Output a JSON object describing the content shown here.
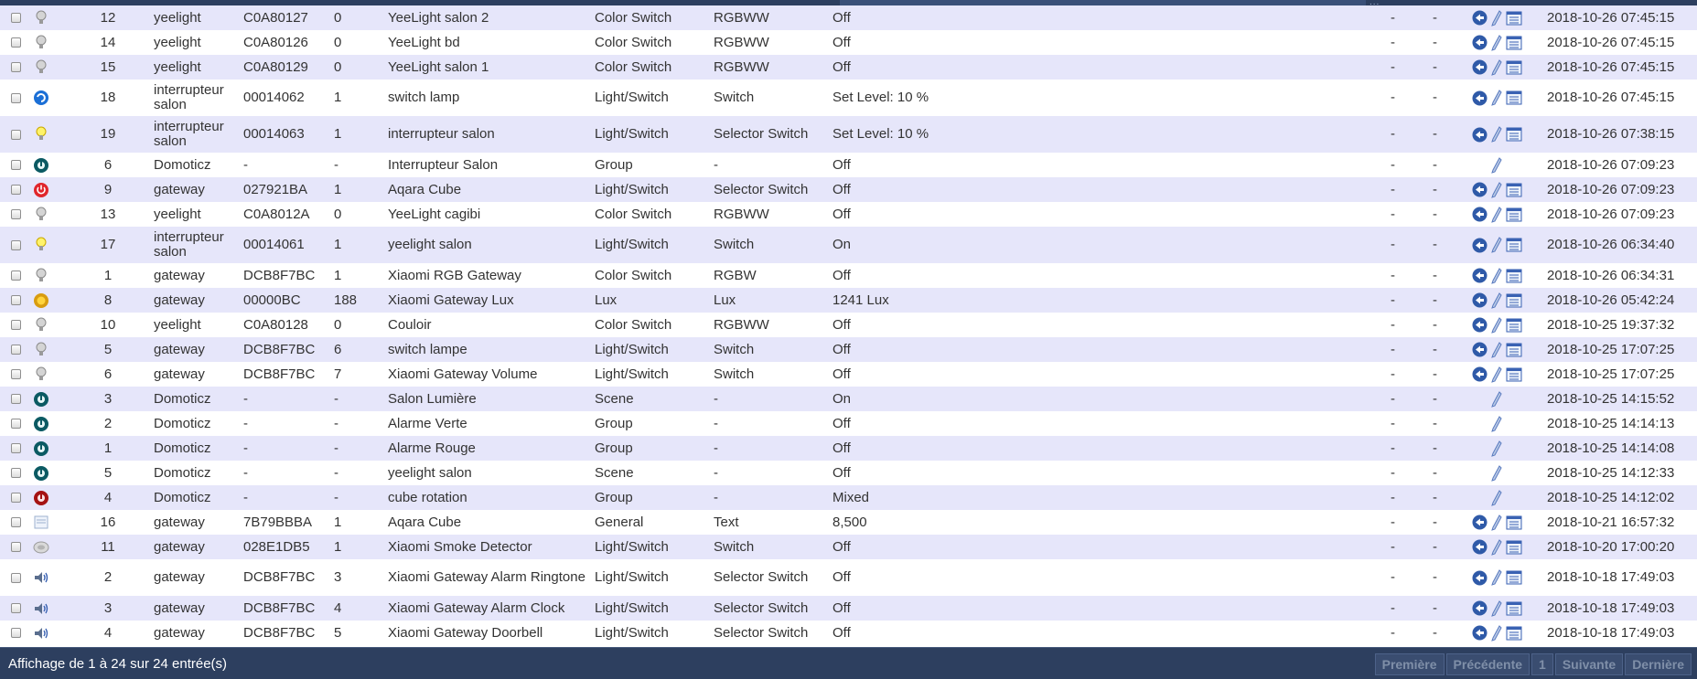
{
  "columns_header": {
    "more": "..."
  },
  "rows": [
    {
      "idx": "12",
      "hardware": "yeelight",
      "id": "C0A80127",
      "unit": "0",
      "name": "YeeLight salon 2",
      "type": "Color Switch",
      "subtype": "RGBWW",
      "data": "Off",
      "a": "-",
      "b": "-",
      "last": "2018-10-26 07:45:15",
      "icon": "bulb-grey-icon",
      "actions": true,
      "tall": false
    },
    {
      "idx": "14",
      "hardware": "yeelight",
      "id": "C0A80126",
      "unit": "0",
      "name": "YeeLight bd",
      "type": "Color Switch",
      "subtype": "RGBWW",
      "data": "Off",
      "a": "-",
      "b": "-",
      "last": "2018-10-26 07:45:15",
      "icon": "bulb-grey-icon",
      "actions": true,
      "tall": false
    },
    {
      "idx": "15",
      "hardware": "yeelight",
      "id": "C0A80129",
      "unit": "0",
      "name": "YeeLight salon 1",
      "type": "Color Switch",
      "subtype": "RGBWW",
      "data": "Off",
      "a": "-",
      "b": "-",
      "last": "2018-10-26 07:45:15",
      "icon": "bulb-grey-icon",
      "actions": true,
      "tall": false
    },
    {
      "idx": "18",
      "hardware": "interrupteur salon",
      "id": "00014062",
      "unit": "1",
      "name": "switch lamp",
      "type": "Light/Switch",
      "subtype": "Switch",
      "data": "Set Level: 10 %",
      "a": "-",
      "b": "-",
      "last": "2018-10-26 07:45:15",
      "icon": "switch-blue-icon",
      "actions": true,
      "tall": true
    },
    {
      "idx": "19",
      "hardware": "interrupteur salon",
      "id": "00014063",
      "unit": "1",
      "name": "interrupteur salon",
      "type": "Light/Switch",
      "subtype": "Selector Switch",
      "data": "Set Level: 10 %",
      "a": "-",
      "b": "-",
      "last": "2018-10-26 07:38:15",
      "icon": "bulb-yellow-icon",
      "actions": true,
      "tall": true
    },
    {
      "idx": "6",
      "hardware": "Domoticz",
      "id": "-",
      "unit": "-",
      "name": "Interrupteur Salon",
      "type": "Group",
      "subtype": "-",
      "data": "Off",
      "a": "-",
      "b": "-",
      "last": "2018-10-26 07:09:23",
      "icon": "group-teal-icon",
      "actions": false,
      "tall": false
    },
    {
      "idx": "9",
      "hardware": "gateway",
      "id": "027921BA",
      "unit": "1",
      "name": "Aqara Cube",
      "type": "Light/Switch",
      "subtype": "Selector Switch",
      "data": "Off",
      "a": "-",
      "b": "-",
      "last": "2018-10-26 07:09:23",
      "icon": "power-red-icon",
      "actions": true,
      "tall": false
    },
    {
      "idx": "13",
      "hardware": "yeelight",
      "id": "C0A8012A",
      "unit": "0",
      "name": "YeeLight cagibi",
      "type": "Color Switch",
      "subtype": "RGBWW",
      "data": "Off",
      "a": "-",
      "b": "-",
      "last": "2018-10-26 07:09:23",
      "icon": "bulb-grey-icon",
      "actions": true,
      "tall": false
    },
    {
      "idx": "17",
      "hardware": "interrupteur salon",
      "id": "00014061",
      "unit": "1",
      "name": "yeelight salon",
      "type": "Light/Switch",
      "subtype": "Switch",
      "data": "On",
      "a": "-",
      "b": "-",
      "last": "2018-10-26 06:34:40",
      "icon": "bulb-yellow-icon",
      "actions": true,
      "tall": true
    },
    {
      "idx": "1",
      "hardware": "gateway",
      "id": "DCB8F7BC",
      "unit": "1",
      "name": "Xiaomi RGB Gateway",
      "type": "Color Switch",
      "subtype": "RGBW",
      "data": "Off",
      "a": "-",
      "b": "-",
      "last": "2018-10-26 06:34:31",
      "icon": "bulb-grey-icon",
      "actions": true,
      "tall": false
    },
    {
      "idx": "8",
      "hardware": "gateway",
      "id": "00000BC",
      "unit": "188",
      "name": "Xiaomi Gateway Lux",
      "type": "Lux",
      "subtype": "Lux",
      "data": "1241 Lux",
      "a": "-",
      "b": "-",
      "last": "2018-10-26 05:42:24",
      "icon": "lux-yellow-icon",
      "actions": true,
      "tall": false
    },
    {
      "idx": "10",
      "hardware": "yeelight",
      "id": "C0A80128",
      "unit": "0",
      "name": "Couloir",
      "type": "Color Switch",
      "subtype": "RGBWW",
      "data": "Off",
      "a": "-",
      "b": "-",
      "last": "2018-10-25 19:37:32",
      "icon": "bulb-grey-icon",
      "actions": true,
      "tall": false
    },
    {
      "idx": "5",
      "hardware": "gateway",
      "id": "DCB8F7BC",
      "unit": "6",
      "name": "switch lampe",
      "type": "Light/Switch",
      "subtype": "Switch",
      "data": "Off",
      "a": "-",
      "b": "-",
      "last": "2018-10-25 17:07:25",
      "icon": "bulb-grey-icon",
      "actions": true,
      "tall": false
    },
    {
      "idx": "6",
      "hardware": "gateway",
      "id": "DCB8F7BC",
      "unit": "7",
      "name": "Xiaomi Gateway Volume",
      "type": "Light/Switch",
      "subtype": "Switch",
      "data": "Off",
      "a": "-",
      "b": "-",
      "last": "2018-10-25 17:07:25",
      "icon": "bulb-grey-icon",
      "actions": true,
      "tall": false
    },
    {
      "idx": "3",
      "hardware": "Domoticz",
      "id": "-",
      "unit": "-",
      "name": "Salon Lumière",
      "type": "Scene",
      "subtype": "-",
      "data": "On",
      "a": "-",
      "b": "-",
      "last": "2018-10-25 14:15:52",
      "icon": "group-teal-icon",
      "actions": false,
      "tall": false
    },
    {
      "idx": "2",
      "hardware": "Domoticz",
      "id": "-",
      "unit": "-",
      "name": "Alarme Verte",
      "type": "Group",
      "subtype": "-",
      "data": "Off",
      "a": "-",
      "b": "-",
      "last": "2018-10-25 14:14:13",
      "icon": "group-teal-icon",
      "actions": false,
      "tall": false
    },
    {
      "idx": "1",
      "hardware": "Domoticz",
      "id": "-",
      "unit": "-",
      "name": "Alarme Rouge",
      "type": "Group",
      "subtype": "-",
      "data": "Off",
      "a": "-",
      "b": "-",
      "last": "2018-10-25 14:14:08",
      "icon": "group-teal-icon",
      "actions": false,
      "tall": false
    },
    {
      "idx": "5",
      "hardware": "Domoticz",
      "id": "-",
      "unit": "-",
      "name": "yeelight salon",
      "type": "Scene",
      "subtype": "-",
      "data": "Off",
      "a": "-",
      "b": "-",
      "last": "2018-10-25 14:12:33",
      "icon": "group-teal-icon",
      "actions": false,
      "tall": false
    },
    {
      "idx": "4",
      "hardware": "Domoticz",
      "id": "-",
      "unit": "-",
      "name": "cube rotation",
      "type": "Group",
      "subtype": "-",
      "data": "Mixed",
      "a": "-",
      "b": "-",
      "last": "2018-10-25 14:12:02",
      "icon": "group-red-icon",
      "actions": false,
      "tall": false
    },
    {
      "idx": "16",
      "hardware": "gateway",
      "id": "7B79BBBA",
      "unit": "1",
      "name": "Aqara Cube",
      "type": "General",
      "subtype": "Text",
      "data": "8,500",
      "a": "-",
      "b": "-",
      "last": "2018-10-21 16:57:32",
      "icon": "text-doc-icon",
      "actions": true,
      "tall": false
    },
    {
      "idx": "11",
      "hardware": "gateway",
      "id": "028E1DB5",
      "unit": "1",
      "name": "Xiaomi Smoke Detector",
      "type": "Light/Switch",
      "subtype": "Switch",
      "data": "Off",
      "a": "-",
      "b": "-",
      "last": "2018-10-20 17:00:20",
      "icon": "smoke-detector-icon",
      "actions": true,
      "tall": false
    },
    {
      "idx": "2",
      "hardware": "gateway",
      "id": "DCB8F7BC",
      "unit": "3",
      "name": "Xiaomi Gateway Alarm Ringtone",
      "type": "Light/Switch",
      "subtype": "Selector Switch",
      "data": "Off",
      "a": "-",
      "b": "-",
      "last": "2018-10-18 17:49:03",
      "icon": "speaker-icon",
      "actions": true,
      "tall": true
    },
    {
      "idx": "3",
      "hardware": "gateway",
      "id": "DCB8F7BC",
      "unit": "4",
      "name": "Xiaomi Gateway Alarm Clock",
      "type": "Light/Switch",
      "subtype": "Selector Switch",
      "data": "Off",
      "a": "-",
      "b": "-",
      "last": "2018-10-18 17:49:03",
      "icon": "speaker-icon",
      "actions": true,
      "tall": false
    },
    {
      "idx": "4",
      "hardware": "gateway",
      "id": "DCB8F7BC",
      "unit": "5",
      "name": "Xiaomi Gateway Doorbell",
      "type": "Light/Switch",
      "subtype": "Selector Switch",
      "data": "Off",
      "a": "-",
      "b": "-",
      "last": "2018-10-18 17:49:03",
      "icon": "speaker-icon",
      "actions": true,
      "tall": false
    }
  ],
  "footer": {
    "info": "Affichage de 1 à 24 sur 24 entrée(s)",
    "first": "Première",
    "prev": "Précédente",
    "page": "1",
    "next": "Suivante",
    "last": "Dernière"
  },
  "colors": {
    "header": "#2d3f5f",
    "row_alt": "#e6e6fa",
    "action_blue": "#3a62b3"
  }
}
